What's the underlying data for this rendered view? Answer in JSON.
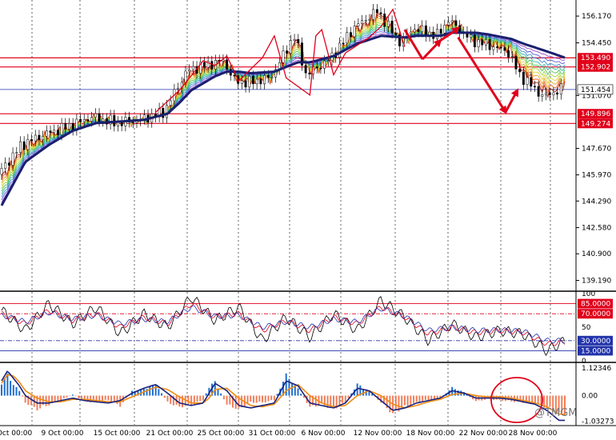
{
  "chart_data": [
    {
      "type": "line",
      "panel": "price",
      "x_labels": [
        "Oct 00:00",
        "9 Oct 00:00",
        "15 Oct 00:00",
        "21 Oct 00:00",
        "25 Oct 00:00",
        "31 Oct 00:00",
        "6 Nov 00:00",
        "12 Nov 00:00",
        "18 Nov 00:00",
        "22 Nov 00:00",
        "28 Nov 00:00"
      ],
      "y_ticks": [
        "156.170",
        "154.450",
        "151.070",
        "147.670",
        "145.970",
        "144.290",
        "142.580",
        "140.900",
        "139.190"
      ],
      "ylim": [
        138.6,
        157.1
      ],
      "current_price": "151.454",
      "levels": [
        {
          "label": "153.490",
          "value": 153.49,
          "color": "#e0001b"
        },
        {
          "label": "152.902",
          "value": 152.902,
          "color": "#e0001b"
        },
        {
          "label": "149.896",
          "value": 149.896,
          "color": "#e0001b"
        },
        {
          "label": "149.274",
          "value": 149.274,
          "color": "#e0001b"
        }
      ],
      "current_line_color": "#2233aa",
      "x": [
        0,
        4,
        8,
        12,
        16,
        20,
        24,
        28,
        30,
        32,
        36,
        38,
        40,
        42,
        46,
        50,
        52,
        56,
        58,
        60,
        64,
        68,
        70,
        74,
        76,
        80,
        82,
        86,
        88,
        92,
        95
      ],
      "close": [
        146.0,
        147.9,
        148.6,
        149.1,
        149.7,
        149.3,
        149.5,
        150.0,
        151.4,
        152.7,
        153.1,
        153.3,
        152.0,
        151.9,
        152.2,
        154.9,
        152.4,
        153.4,
        154.4,
        155.4,
        156.5,
        154.4,
        155.4,
        154.9,
        155.9,
        154.6,
        154.4,
        153.9,
        152.4,
        151.0,
        151.454
      ],
      "ma_slow": [
        144.0,
        146.8,
        147.9,
        148.8,
        149.3,
        149.4,
        149.5,
        149.9,
        150.6,
        151.4,
        152.3,
        152.6,
        152.6,
        152.5,
        152.6,
        153.2,
        153.2,
        153.6,
        154.0,
        154.4,
        154.9,
        154.8,
        154.9,
        154.9,
        155.1,
        155.1,
        155.0,
        154.7,
        154.4,
        153.9,
        153.5
      ],
      "ribbon_colors": [
        "#c41b0f",
        "#e2601d",
        "#e9a227",
        "#dcd43a",
        "#9fd447",
        "#50c35a",
        "#33b59a",
        "#3a8fd0",
        "#5a5ad6",
        "#9a46c6"
      ],
      "arrow_color": "#e0001b"
    },
    {
      "type": "line",
      "panel": "stochastic",
      "levels": [
        {
          "label": "85.0000",
          "value": 85,
          "color": "#e0001b"
        },
        {
          "label": "70.0000",
          "value": 70,
          "color": "#e0001b"
        },
        {
          "label": "30.0000",
          "value": 30,
          "color": "#2233aa"
        },
        {
          "label": "15.0000",
          "value": 15,
          "color": "#2233aa"
        }
      ],
      "y_ticks": [
        "100",
        "50",
        "0"
      ],
      "ylim": [
        0,
        100
      ],
      "x": [
        0,
        4,
        8,
        12,
        16,
        20,
        24,
        28,
        32,
        36,
        40,
        44,
        48,
        52,
        56,
        60,
        64,
        68,
        72,
        76,
        80,
        84,
        88,
        92,
        95
      ],
      "series": [
        {
          "color": "#000000",
          "values": [
            75,
            45,
            85,
            55,
            80,
            40,
            70,
            50,
            95,
            60,
            80,
            30,
            65,
            35,
            70,
            45,
            90,
            65,
            30,
            55,
            35,
            45,
            40,
            15,
            30
          ]
        },
        {
          "color": "#e0001b",
          "values": [
            70,
            55,
            75,
            60,
            70,
            50,
            65,
            55,
            85,
            65,
            70,
            45,
            60,
            45,
            65,
            55,
            80,
            65,
            40,
            50,
            42,
            45,
            42,
            25,
            28
          ]
        },
        {
          "color": "#2233aa",
          "values": [
            68,
            58,
            72,
            62,
            68,
            55,
            62,
            58,
            80,
            66,
            68,
            50,
            58,
            50,
            62,
            58,
            78,
            66,
            45,
            50,
            45,
            46,
            44,
            30,
            30
          ]
        }
      ]
    },
    {
      "type": "bar",
      "panel": "oscillator",
      "y_ticks": [
        "1.12346",
        "0.00",
        "-1.03273"
      ],
      "ylim": [
        -1.15,
        1.25
      ],
      "bar_colors": {
        "positive": "#1f6fd0",
        "negative": "#f07f5b"
      },
      "x": [
        0,
        1,
        2,
        3,
        4,
        6,
        8,
        10,
        12,
        14,
        16,
        18,
        20,
        22,
        24,
        26,
        28,
        30,
        32,
        34,
        35,
        36,
        38,
        40,
        42,
        44,
        46,
        48,
        50,
        52,
        54,
        56,
        58,
        60,
        62,
        64,
        66,
        68,
        70,
        72,
        74,
        76,
        78,
        80,
        82,
        84,
        86,
        88,
        90,
        92,
        94
      ],
      "values": [
        0.6,
        0.9,
        0.5,
        0.2,
        -0.3,
        -0.6,
        -0.4,
        -0.2,
        0.05,
        -0.25,
        -0.3,
        -0.2,
        -0.45,
        0.2,
        0.3,
        0.5,
        -0.3,
        -0.5,
        -0.4,
        -0.2,
        0.4,
        0.6,
        -0.4,
        -0.6,
        -0.3,
        -0.3,
        -0.2,
        0.9,
        0.3,
        -0.5,
        -0.4,
        -0.6,
        -0.3,
        0.5,
        0.2,
        -0.3,
        -0.8,
        -0.5,
        -0.3,
        -0.2,
        -0.1,
        0.35,
        0.15,
        -0.25,
        -0.15,
        -0.2,
        -0.25,
        -0.3,
        -0.35,
        -0.55,
        -0.8
      ],
      "line_values": [
        0.6,
        1.0,
        0.7,
        0.4,
        0.0,
        -0.3,
        -0.3,
        -0.2,
        -0.1,
        -0.2,
        -0.25,
        -0.3,
        -0.2,
        0.1,
        0.3,
        0.45,
        0.1,
        -0.3,
        -0.4,
        -0.3,
        0.1,
        0.5,
        0.2,
        -0.4,
        -0.5,
        -0.4,
        -0.3,
        0.6,
        0.4,
        -0.3,
        -0.4,
        -0.5,
        -0.3,
        0.3,
        0.2,
        -0.2,
        -0.6,
        -0.5,
        -0.3,
        -0.2,
        -0.1,
        0.2,
        0.1,
        -0.1,
        -0.1,
        -0.1,
        -0.15,
        -0.25,
        -0.35,
        -0.6,
        -1.0
      ],
      "signal_values": [
        0.5,
        0.85,
        0.8,
        0.55,
        0.2,
        -0.1,
        -0.25,
        -0.25,
        -0.15,
        -0.15,
        -0.2,
        -0.25,
        -0.25,
        -0.05,
        0.15,
        0.35,
        0.25,
        -0.05,
        -0.3,
        -0.3,
        -0.1,
        0.25,
        0.3,
        -0.1,
        -0.4,
        -0.45,
        -0.35,
        0.2,
        0.45,
        0.0,
        -0.3,
        -0.45,
        -0.4,
        0.0,
        0.2,
        0.0,
        -0.35,
        -0.5,
        -0.4,
        -0.25,
        -0.15,
        0.05,
        0.1,
        0.0,
        -0.05,
        -0.05,
        -0.1,
        -0.2,
        -0.3,
        -0.45,
        -0.75
      ],
      "line_color": "#1a237e",
      "signal_color": "#f08c12",
      "circle_color": "#e0001b",
      "watermark": "@TMGM"
    }
  ]
}
